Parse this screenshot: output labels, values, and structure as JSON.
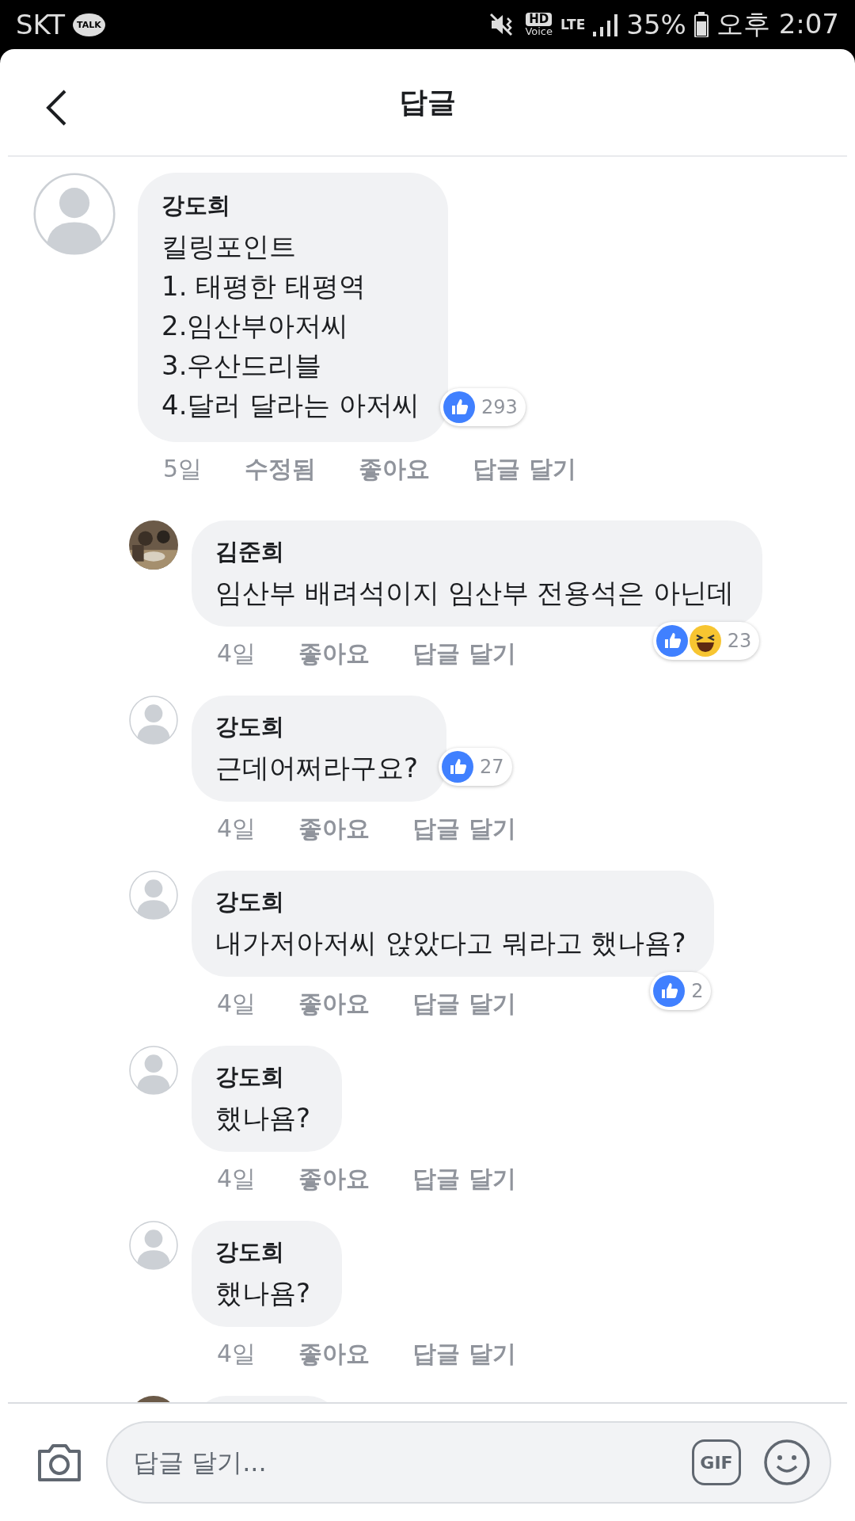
{
  "status_bar": {
    "carrier": "SKT",
    "talk_badge": "TALK",
    "hd": "HD",
    "voice": "Voice",
    "network": "LTE",
    "battery": "35%",
    "time": "오후 2:07"
  },
  "header": {
    "title": "답글"
  },
  "comments": [
    {
      "author": "강도희",
      "avatar": {
        "kind": "default"
      },
      "text": "킬링포인트\n1. 태평한 태평역\n2.임산부아저씨\n3.우산드리블\n4.달러 달라는 아저씨",
      "reactions": {
        "icons": [
          {
            "kind": "like"
          }
        ],
        "count": "293"
      },
      "time": "5일",
      "edited": "수정됨",
      "like": "좋아요",
      "reply": "답글 달기",
      "children": [
        {
          "author": "김준희",
          "avatar": {
            "kind": "picture"
          },
          "text": "임산부 배려석이지 임산부 전용석은 아닌데",
          "reactions": {
            "icons": [
              {
                "kind": "like"
              },
              {
                "kind": "haha"
              }
            ],
            "count": "23"
          },
          "time": "4일",
          "like": "좋아요",
          "reply": "답글 달기"
        },
        {
          "author": "강도희",
          "avatar": {
            "kind": "default"
          },
          "text": "근데어쩌라구요?",
          "reactions": {
            "icons": [
              {
                "kind": "like"
              }
            ],
            "count": "27"
          },
          "time": "4일",
          "like": "좋아요",
          "reply": "답글 달기"
        },
        {
          "author": "강도희",
          "avatar": {
            "kind": "default"
          },
          "text": "내가저아저씨 앉았다고 뭐라고 했나욤?",
          "reactions": {
            "icons": [
              {
                "kind": "like"
              }
            ],
            "count": "2"
          },
          "time": "4일",
          "like": "좋아요",
          "reply": "답글 달기"
        },
        {
          "author": "강도희",
          "avatar": {
            "kind": "default"
          },
          "text": "했나욤?",
          "time": "4일",
          "like": "좋아요",
          "reply": "답글 달기"
        },
        {
          "author": "강도희",
          "avatar": {
            "kind": "default"
          },
          "text": "했나욤?",
          "time": "4일",
          "like": "좋아요",
          "reply": "답글 달기"
        },
        {
          "avatar": {
            "kind": "picture"
          }
        }
      ]
    }
  ],
  "composer": {
    "placeholder": "답글 달기...",
    "gif": "GIF"
  }
}
